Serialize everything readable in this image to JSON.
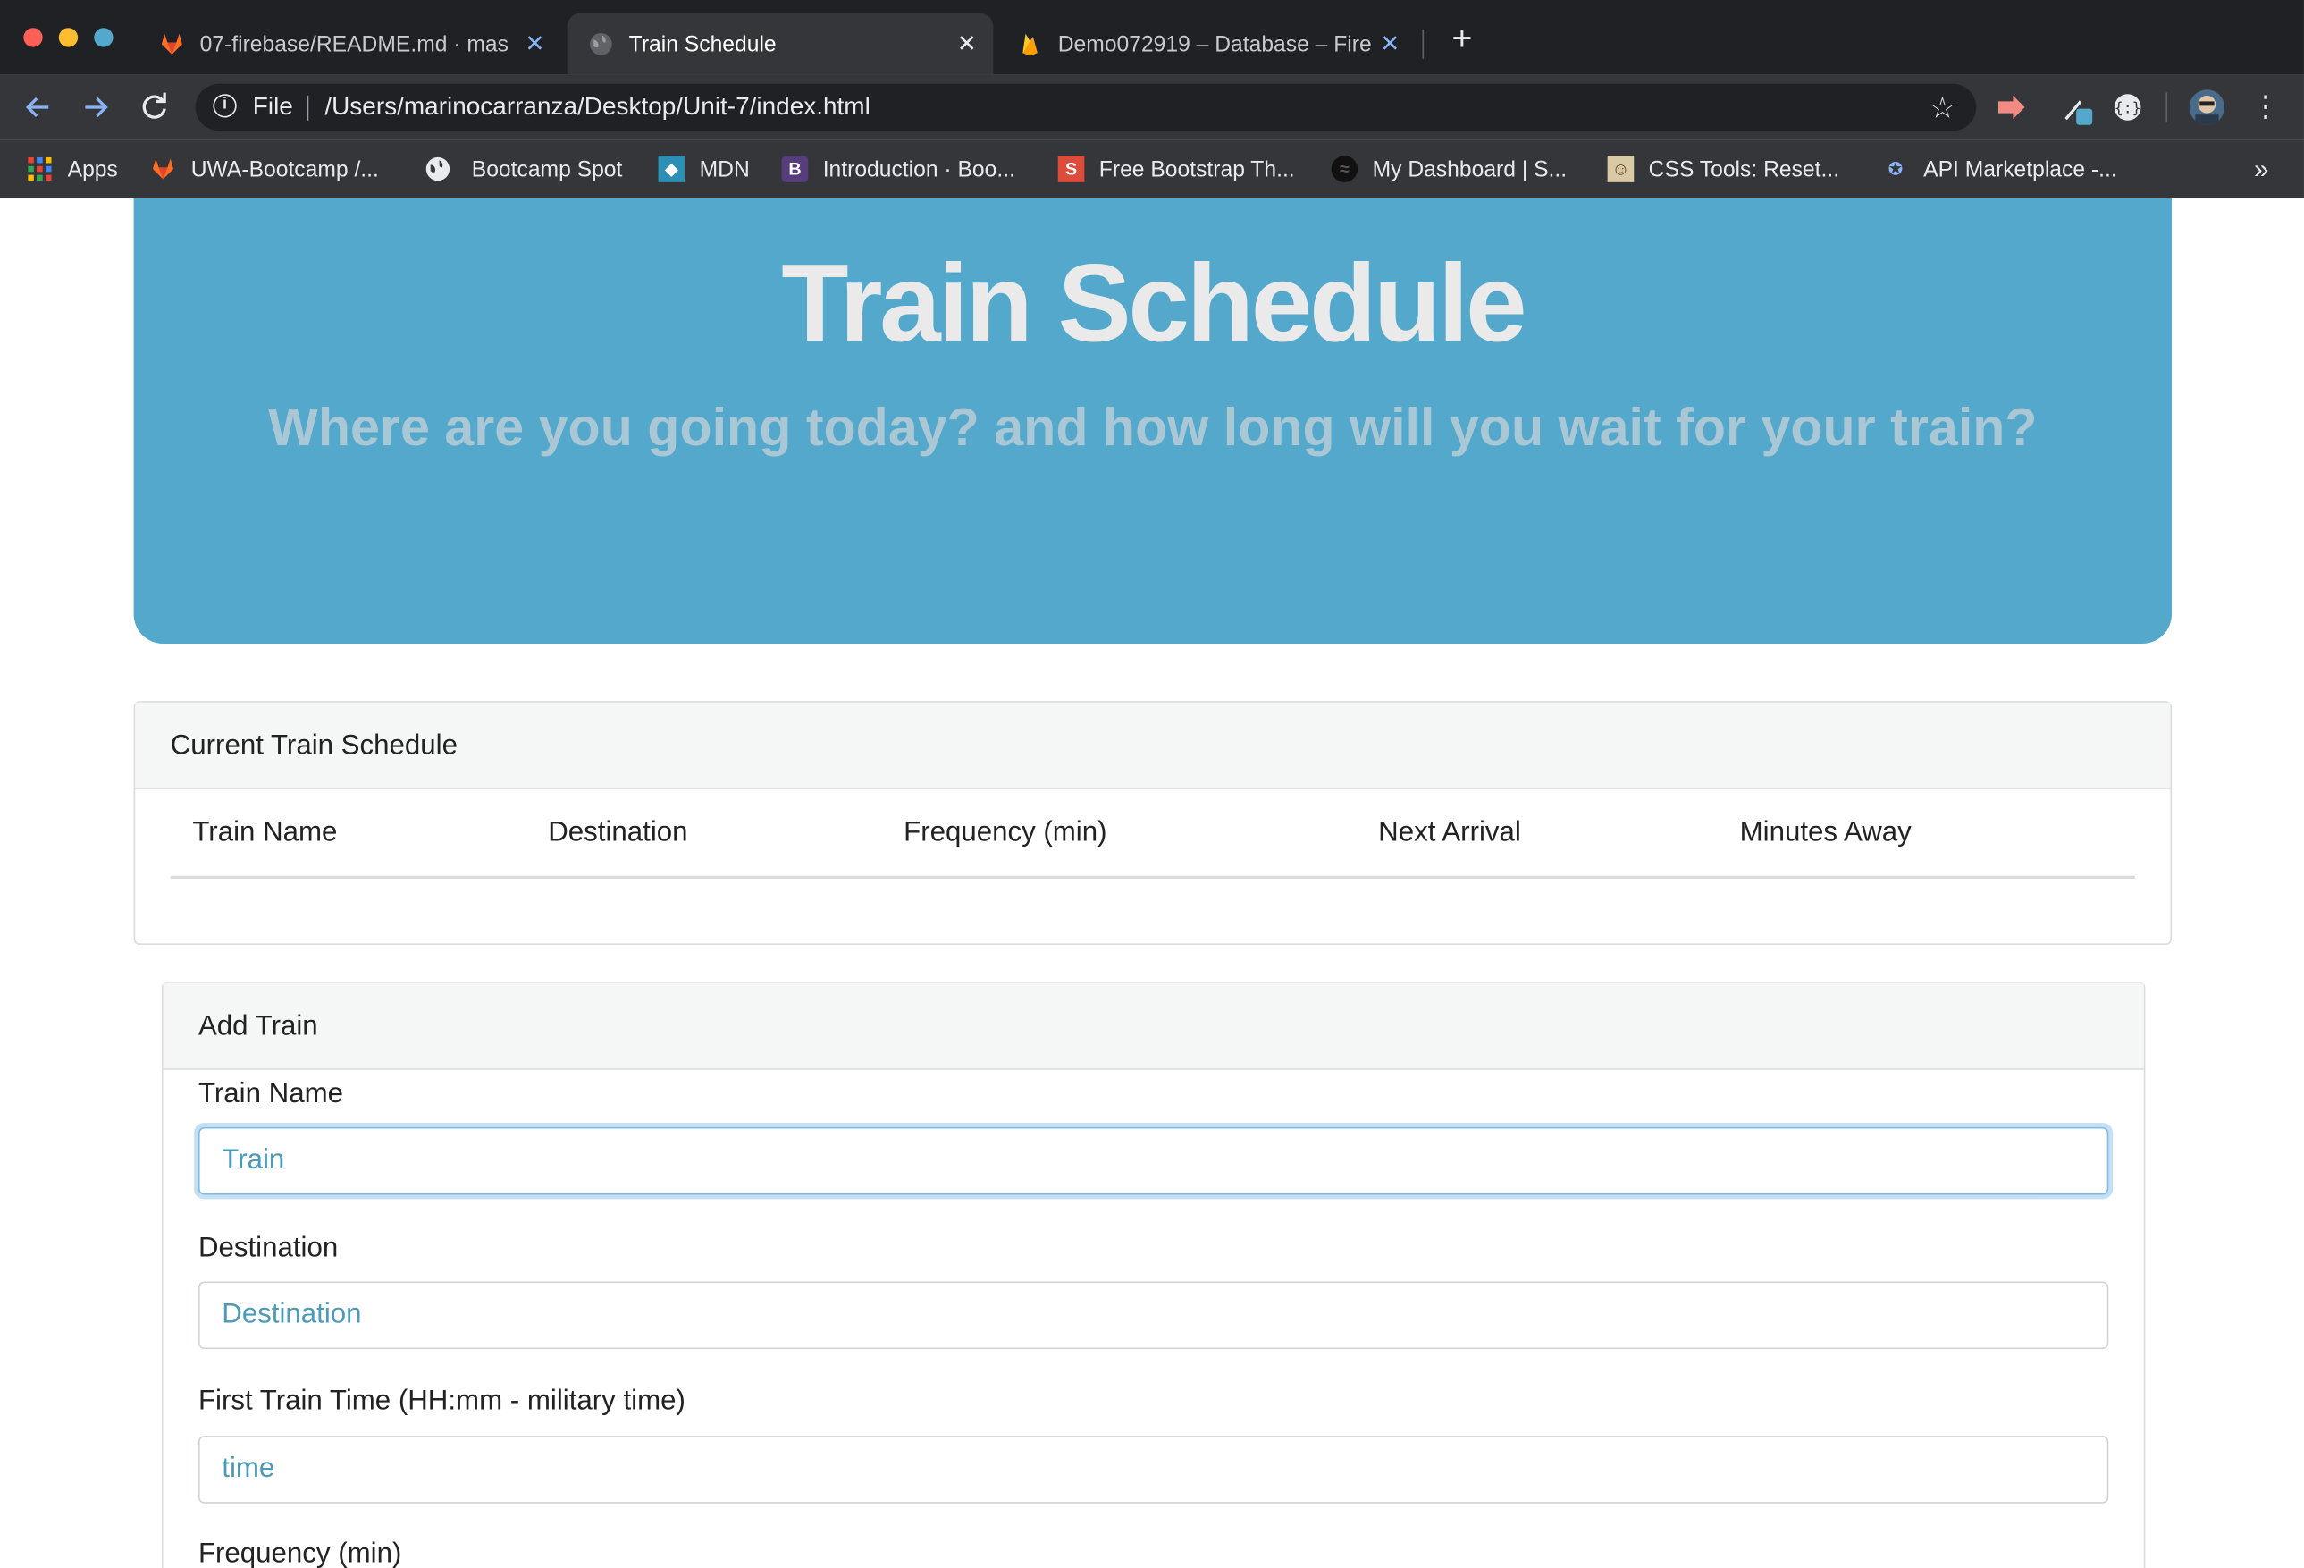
{
  "browser": {
    "tabs": [
      {
        "title": "07-firebase/README.md · mas",
        "active": false,
        "icon": "gitlab-icon"
      },
      {
        "title": "Train Schedule",
        "active": true,
        "icon": "globe-icon"
      },
      {
        "title": "Demo072919 – Database – Fire",
        "active": false,
        "icon": "firebase-icon"
      }
    ],
    "new_tab_label": "+",
    "address": {
      "scheme_label": "File",
      "url": "/Users/marinocarranza/Desktop/Unit-7/index.html"
    },
    "bookmarks": [
      {
        "label": "Apps",
        "icon": "apps-grid-icon"
      },
      {
        "label": "UWA-Bootcamp /...",
        "icon": "gitlab-icon"
      },
      {
        "label": "Bootcamp Spot",
        "icon": "globe-icon"
      },
      {
        "label": "MDN",
        "icon": "mdn-icon"
      },
      {
        "label": "Introduction · Boo...",
        "icon": "bootstrap-icon"
      },
      {
        "label": "Free Bootstrap Th...",
        "icon": "startbootstrap-icon"
      },
      {
        "label": "My Dashboard | S...",
        "icon": "spotify-icon"
      },
      {
        "label": "CSS Tools: Reset...",
        "icon": "meyer-icon"
      },
      {
        "label": "API Marketplace -...",
        "icon": "rapidapi-icon"
      }
    ],
    "bookmarks_overflow": "»"
  },
  "jumbotron": {
    "title": "Train Schedule",
    "subtitle": "Where are you going today? and how long will you wait for your train?"
  },
  "schedule": {
    "header": "Current Train Schedule",
    "columns": [
      "Train Name",
      "Destination",
      "Frequency (min)",
      "Next Arrival",
      "Minutes Away"
    ]
  },
  "add_train": {
    "header": "Add Train",
    "fields": [
      {
        "label": "Train Name",
        "placeholder": "Train",
        "value": ""
      },
      {
        "label": "Destination",
        "placeholder": "Destination",
        "value": ""
      },
      {
        "label": "First Train Time (HH:mm - military time)",
        "placeholder": "time",
        "value": ""
      },
      {
        "label": "Frequency (min)",
        "placeholder": "",
        "value": ""
      }
    ]
  },
  "colors": {
    "jumbotron": "#54a8cb",
    "title_text": "#eaeaea",
    "placeholder": "#4a9ab8",
    "chrome_dark": "#202124",
    "chrome_toolbar": "#35363a"
  }
}
